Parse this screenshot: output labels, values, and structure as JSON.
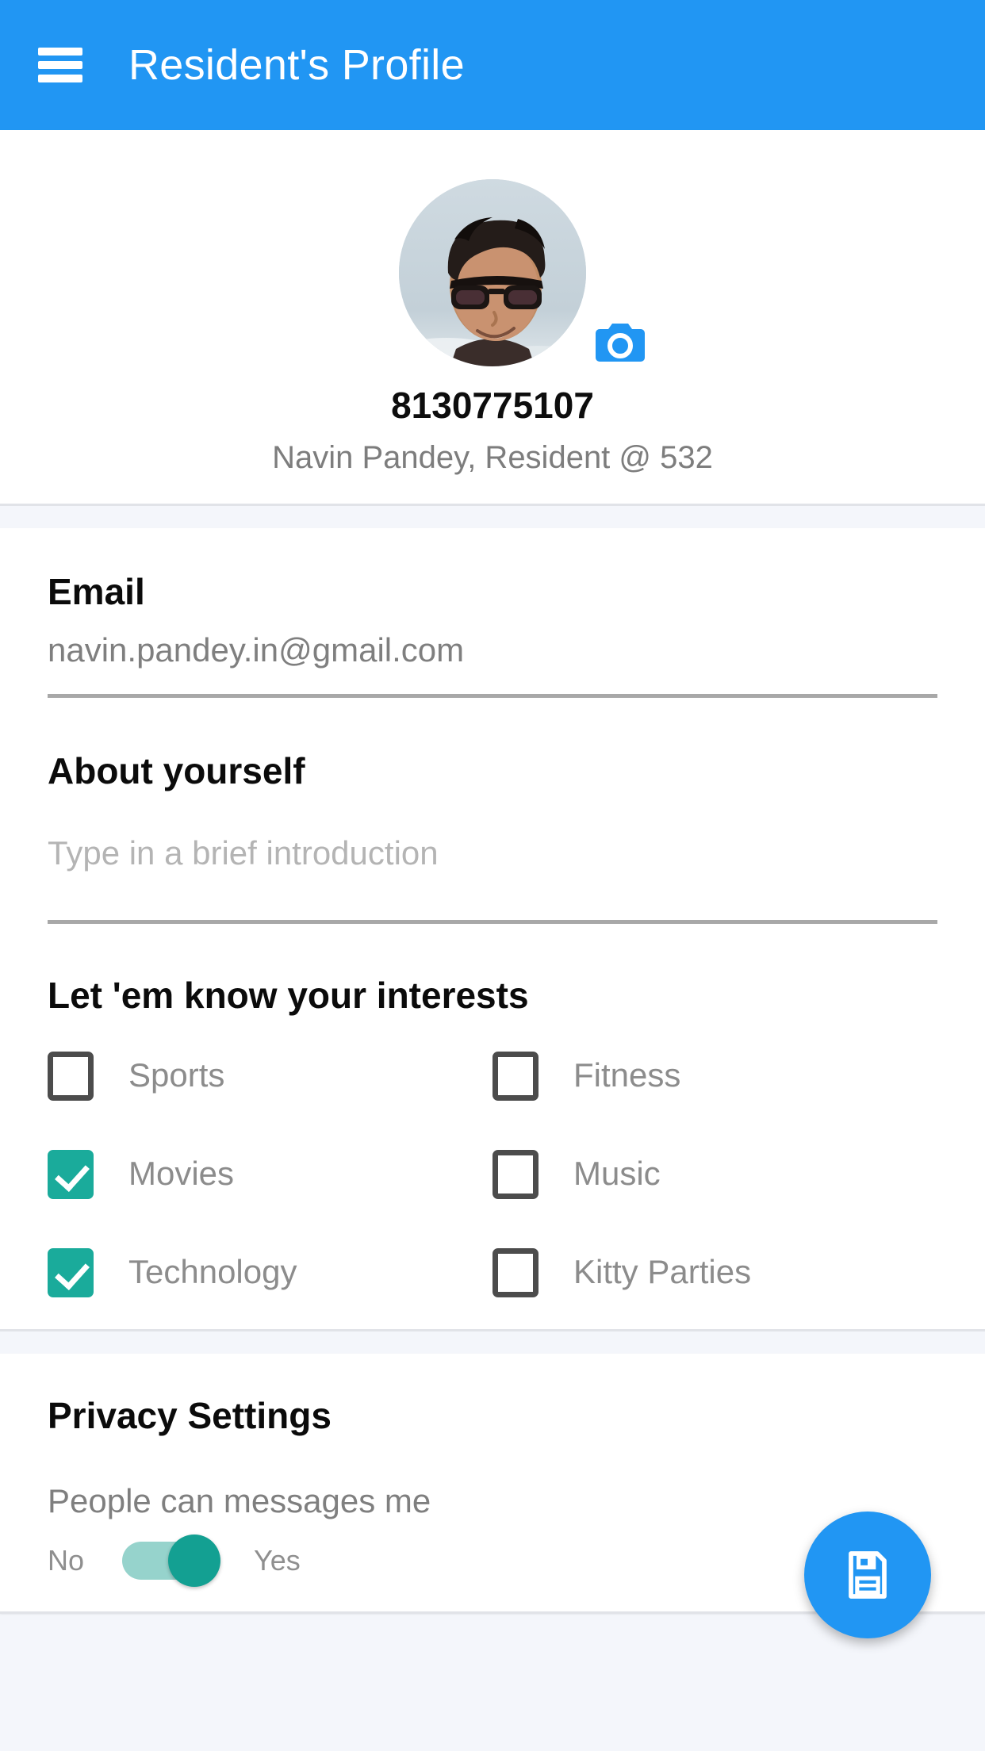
{
  "appbar": {
    "menu_icon": "hamburger-menu-icon",
    "title": "Resident's Profile",
    "background_color": "#2196F3"
  },
  "profile": {
    "avatar_alt": "user-avatar-photo",
    "camera_icon": "camera-icon",
    "phone": "8130775107",
    "subtitle": "Navin Pandey, Resident @ 532"
  },
  "form": {
    "email": {
      "label": "Email",
      "value": "navin.pandey.in@gmail.com"
    },
    "about": {
      "label": "About yourself",
      "placeholder": "Type in a brief introduction",
      "value": ""
    },
    "interests": {
      "title": "Let 'em know your interests",
      "items": [
        {
          "label": "Sports",
          "checked": false
        },
        {
          "label": "Fitness",
          "checked": false
        },
        {
          "label": "Movies",
          "checked": true
        },
        {
          "label": "Music",
          "checked": false
        },
        {
          "label": "Technology",
          "checked": true
        },
        {
          "label": "Kitty Parties",
          "checked": false
        }
      ],
      "checked_color": "#1AAB9B"
    }
  },
  "privacy": {
    "title": "Privacy Settings",
    "rows": [
      {
        "label": "People can messages me",
        "off_label": "No",
        "on_label": "Yes",
        "value": true
      }
    ],
    "toggle_on_color": "#13A092"
  },
  "fab": {
    "icon": "save-floppy-disk-icon",
    "color": "#2196F3"
  }
}
